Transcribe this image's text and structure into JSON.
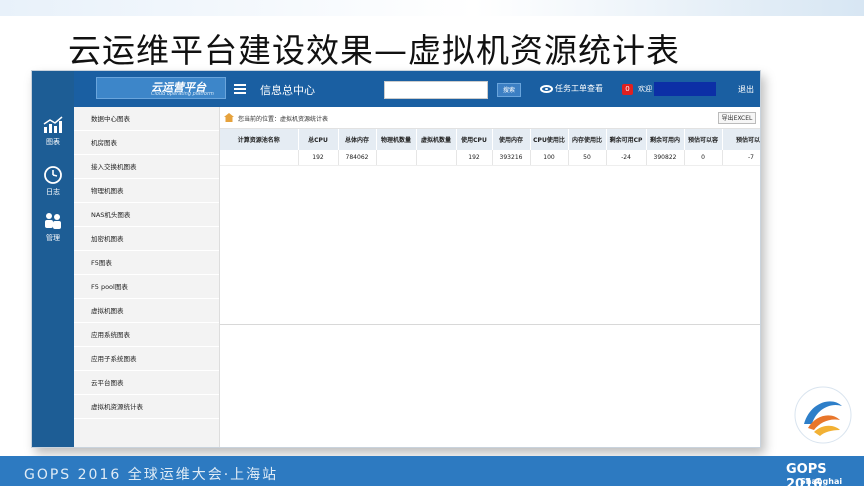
{
  "slide": {
    "title": "云运维平台建设效果—虚拟机资源统计表"
  },
  "app": {
    "logo_text": "云运营平台",
    "logo_subtext": "Cloud operating platform",
    "header_title": "信息总中心",
    "search": {
      "value": "",
      "button_label": "搜索"
    },
    "task_link": "任务工单查看",
    "notification_count": "0",
    "welcome": "欢迎",
    "logout": "退出"
  },
  "rail": [
    {
      "label": "图表",
      "icon": "chart-icon",
      "active": true
    },
    {
      "label": "日志",
      "icon": "clock-icon",
      "active": false
    },
    {
      "label": "管理",
      "icon": "users-icon",
      "active": false
    }
  ],
  "side_menu": [
    "数据中心图表",
    "机房图表",
    "接入交换机图表",
    "物理机图表",
    "NAS机头图表",
    "加密机图表",
    "F5图表",
    "F5 pool图表",
    "虚拟机图表",
    "应用系统图表",
    "应用子系统图表",
    "云平台图表",
    "虚拟机资源统计表"
  ],
  "breadcrumb": "您当前的位置：虚拟机资源统计表",
  "export_button": "导出EXCEL",
  "table": {
    "columns": [
      "计算资源池名称",
      "总CPU",
      "总体内存",
      "物理机数量",
      "虚拟机数量",
      "使用CPU",
      "使用内存",
      "CPU使用比",
      "内存使用比",
      "剩余可用CP",
      "剩余可用内",
      "预估可以容",
      "预估可以容"
    ],
    "rows": [
      [
        "",
        "192",
        "784062",
        "",
        "",
        "192",
        "393216",
        "100",
        "50",
        "-24",
        "390822",
        "0",
        "-7"
      ]
    ]
  },
  "banner": {
    "left_text": "GOPS 2016 全球运维大会·上海站",
    "right_title": "GOPS 2016",
    "right_sub": "Shanghai"
  }
}
